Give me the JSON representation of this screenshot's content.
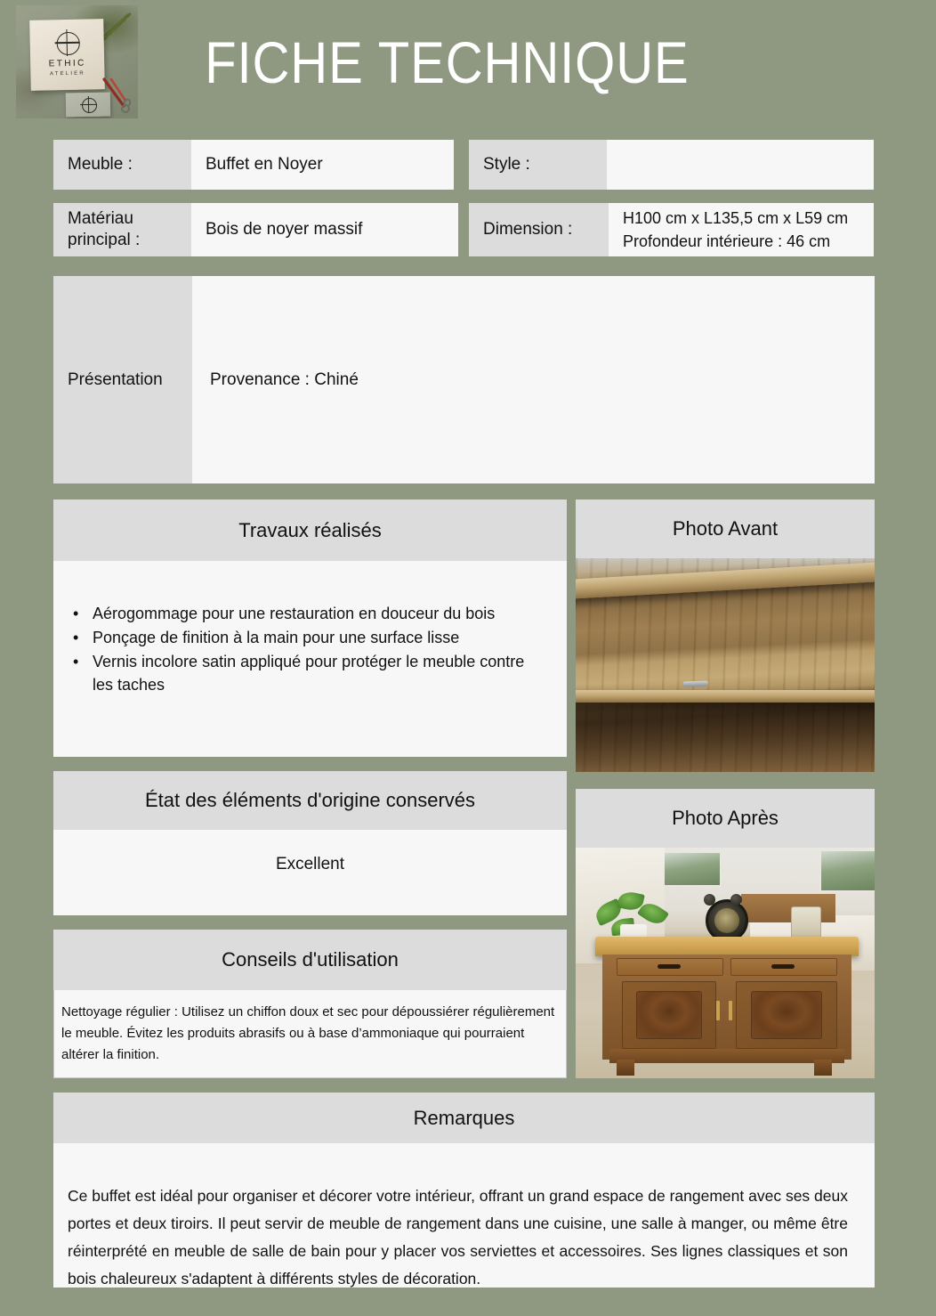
{
  "header": {
    "title": "FICHE TECHNIQUE",
    "logo": {
      "brand": "ETHIC",
      "sub": "ATELIER"
    }
  },
  "fields": {
    "meuble": {
      "label": "Meuble :",
      "value": "Buffet en Noyer"
    },
    "style": {
      "label": "Style :",
      "value": ""
    },
    "materiau": {
      "label": "Matériau principal :",
      "value": "Bois de noyer massif"
    },
    "dimension": {
      "label": "Dimension :",
      "line1": "H100 cm x L135,5 cm x L59 cm",
      "line2": "Profondeur intérieure : 46 cm"
    }
  },
  "presentation": {
    "label": "Présentation",
    "value": "Provenance : Chiné"
  },
  "travaux": {
    "title": "Travaux réalisés",
    "items": [
      "Aérogommage pour une restauration en douceur du bois",
      "Ponçage de finition à la main pour une surface lisse",
      "Vernis incolore satin appliqué pour protéger le meuble contre les taches"
    ]
  },
  "etat": {
    "title": "État des éléments d'origine conservés",
    "value": "Excellent"
  },
  "conseils": {
    "title": "Conseils d'utilisation",
    "text": "Nettoyage régulier : Utilisez un chiffon doux et sec pour dépoussiérer régulièrement le meuble. Évitez les produits abrasifs ou à base d’ammoniaque qui pourraient altérer la finition."
  },
  "photo_avant": {
    "title": "Photo Avant"
  },
  "photo_apres": {
    "title": "Photo Après"
  },
  "remarques": {
    "title": "Remarques",
    "text": "Ce buffet est idéal pour organiser et décorer votre intérieur, offrant un grand espace de rangement avec ses deux portes et deux tiroirs. Il peut servir de meuble de rangement dans une cuisine, une salle à manger, ou même être réinterprété en meuble de salle de bain pour y placer vos serviettes et accessoires. Ses lignes classiques et son bois chaleureux s'adaptent à différents styles de décoration."
  },
  "colors": {
    "background": "#8f9880",
    "panel_header": "#dcdcdc",
    "panel_body": "#f7f7f7",
    "title_text": "#ffffff"
  }
}
